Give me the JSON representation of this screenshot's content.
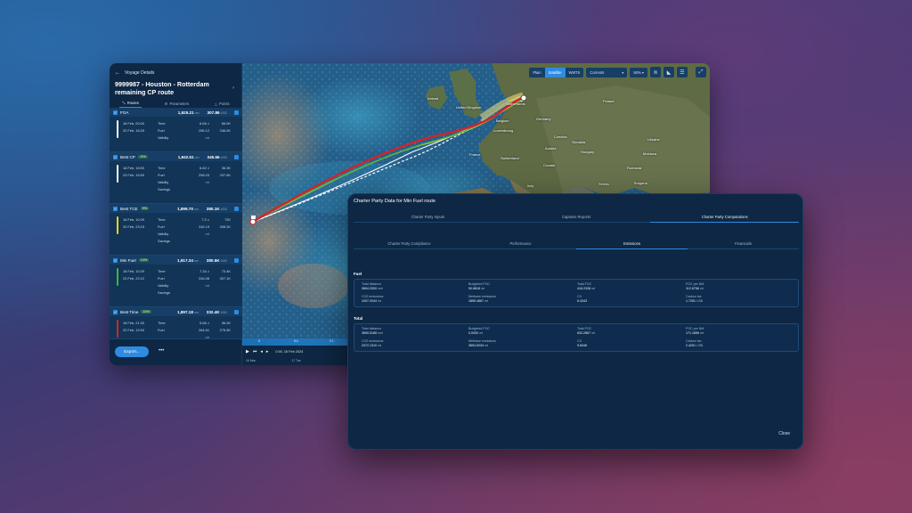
{
  "voyage": {
    "back_label": "Voyage Details",
    "title": "9999987 - Houston - Rotterdam remaining CP route",
    "tabs": [
      "Routes",
      "Parameters",
      "Points"
    ]
  },
  "routes": [
    {
      "name": "FOA",
      "pct": "",
      "dist": "1,925.21",
      "dist_unit": "nm",
      "cost": "307.86",
      "cost_unit": "USD",
      "date1": "16 Feb, 00:00",
      "date2": "22 Feb, 16:25",
      "rows": [
        [
          "Time",
          "6.68",
          "d",
          "66.0K"
        ],
        [
          "Fuel",
          "256.12",
          "mt",
          "246.0K"
        ],
        [
          "Validity",
          "",
          "",
          ""
        ]
      ],
      "color": "#ffffff"
    },
    {
      "name": "Best CP",
      "pct": "-9%",
      "dist": "1,942.51",
      "dist_unit": "nm",
      "cost": "345.56",
      "cost_unit": "USD",
      "date1": "16 Feb, 18:00",
      "date2": "23 Feb, 15:50",
      "rows": [
        [
          "Time",
          "6.82",
          "d",
          "36.3K"
        ],
        [
          "Fuel",
          "298.03",
          "mt",
          "297.6K"
        ],
        [
          "Validity",
          "",
          "",
          ""
        ],
        [
          "Savings",
          "",
          "",
          ""
        ]
      ],
      "color": "#ffffff"
    },
    {
      "name": "Best TCE",
      "pct": "9%",
      "dist": "1,899.70",
      "dist_unit": "nm",
      "cost": "380.1K",
      "cost_unit": "USD",
      "date1": "16 Feb, 10:29",
      "date2": "22 Feb, 23:15",
      "rows": [
        [
          "Time",
          "7.3",
          "d",
          "72K"
        ],
        [
          "Fuel",
          "316.19",
          "mt",
          "308.2K"
        ],
        [
          "Validity",
          "",
          "",
          ""
        ],
        [
          "Savings",
          "",
          "",
          ""
        ]
      ],
      "color": "#f2d21b"
    },
    {
      "name": "Min Fuel",
      "pct": "14%",
      "dist": "1,917.34",
      "dist_unit": "nm",
      "cost": "380.5K",
      "cost_unit": "USD",
      "date1": "16 Feb, 10:29",
      "date2": "23 Feb, 22:12",
      "rows": [
        [
          "Time",
          "7.34",
          "d",
          "73.4K"
        ],
        [
          "Fuel",
          "316.08",
          "mt",
          "307.1K"
        ],
        [
          "Validity",
          "",
          "",
          ""
        ],
        [
          "Savings",
          "",
          "",
          ""
        ]
      ],
      "color": "#3fb34a"
    },
    {
      "name": "Best Time",
      "pct": "16%",
      "dist": "1,897.18",
      "dist_unit": "nm",
      "cost": "332.4K",
      "cost_unit": "USD",
      "date1": "16 Feb, 21:30",
      "date2": "22 Feb, 12:00",
      "rows": [
        [
          "Time",
          "5.66",
          "d",
          "56.0K"
        ],
        [
          "Fuel",
          "264.61",
          "mt",
          "275.9K"
        ]
      ],
      "color": "#d6222a"
    }
  ],
  "sidebar": {
    "export_label": "Export...",
    "more_label": "•••"
  },
  "map": {
    "toolbar": {
      "segments": [
        "Plain",
        "Satellite",
        "WMTS"
      ],
      "active": "Satellite",
      "layer": "Currents",
      "zoom": "50%"
    },
    "countries": [
      {
        "name": "Ireland"
      },
      {
        "name": "United Kingdom"
      },
      {
        "name": "Netherlands"
      },
      {
        "name": "Belgium"
      },
      {
        "name": "Luxembourg"
      },
      {
        "name": "Germany"
      },
      {
        "name": "Poland"
      },
      {
        "name": "Czechia"
      },
      {
        "name": "Slovakia"
      },
      {
        "name": "Ukraine"
      },
      {
        "name": "Hungary"
      },
      {
        "name": "Moldova"
      },
      {
        "name": "Romania"
      },
      {
        "name": "Austria"
      },
      {
        "name": "Switzerland"
      },
      {
        "name": "France"
      },
      {
        "name": "Croatia"
      },
      {
        "name": "Serbia"
      },
      {
        "name": "Bulgaria"
      },
      {
        "name": "Italy"
      }
    ],
    "timeline": {
      "date": "0:00, 16 Feb 2024",
      "ticks": [
        "16 Mon",
        "17 Tue"
      ]
    }
  },
  "dialog": {
    "title": "Charter Party Data for Min Fuel route",
    "tabs1": [
      "Charter Party Inputs",
      "Captains Reports",
      "Charter Party Computations"
    ],
    "tabs1_active": "Charter Party Computations",
    "tabs2": [
      "Charter Party Compliance",
      "Performance",
      "Emissions",
      "Financials"
    ],
    "tabs2_active": "Emissions",
    "sections": [
      {
        "label": "Fuel",
        "cells": [
          [
            "Total distance",
            "3694.2000",
            "nmi"
          ],
          [
            "Budgeted FOC",
            "90.6818",
            "mt"
          ],
          [
            "Total FOC",
            "416.2338",
            "mt"
          ],
          [
            "FOC per NM",
            "112.6758",
            "mt"
          ],
          [
            "CO2 emissions",
            "1007.2044",
            "mt"
          ],
          [
            "Methane emissions",
            "1895.4867",
            "mt"
          ],
          [
            "CII",
            "6.4343",
            ""
          ],
          [
            "Carbon tax",
            "1.7251",
            "US$"
          ]
        ]
      },
      {
        "label": "Total",
        "cells": [
          [
            "Total distance",
            "3650.5185",
            "nmi"
          ],
          [
            "Budgeted FOC",
            "0.0000",
            "mt"
          ],
          [
            "Total FOC",
            "632.2857",
            "mt"
          ],
          [
            "FOC per NM",
            "171.1656",
            "mt"
          ],
          [
            "CO2 emissions",
            "2372.1310",
            "mt"
          ],
          [
            "Methane emissions",
            "3694.5234",
            "mt"
          ],
          [
            "CII",
            "9.6046",
            ""
          ],
          [
            "Carbon tax",
            "2.4251",
            "US$"
          ]
        ]
      }
    ],
    "close_label": "Close"
  },
  "colors": {
    "accent": "#2f8be0",
    "panel": "#0e2744",
    "route_best_time": "#d6222a",
    "route_min_fuel": "#3fb34a",
    "route_best_tce": "#f2d21b"
  }
}
